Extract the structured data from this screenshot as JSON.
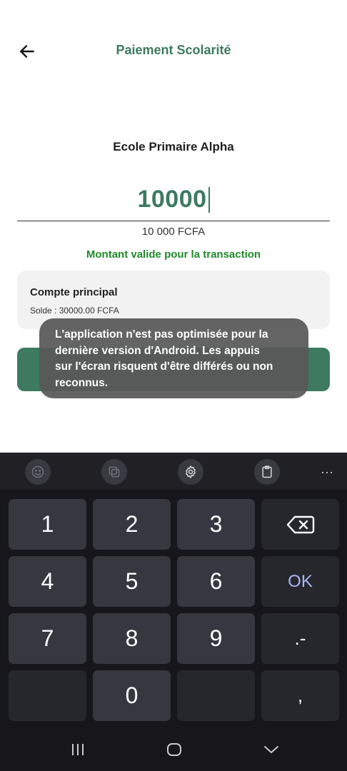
{
  "header": {
    "title": "Paiement Scolarité",
    "back_icon": "arrow-left-icon"
  },
  "payment": {
    "school_name": "Ecole Primaire Alpha",
    "amount": "10000",
    "formatted_amount": "10 000 FCFA",
    "validation_message": "Montant valide pour la transaction"
  },
  "account": {
    "name": "Compte principal",
    "balance": "Solde : 30000.00 FCFA"
  },
  "toast": {
    "lines": [
      "L'application  n'est pas optimisée pour la",
      "dernière version d'Android. Les appuis",
      "sur l'écran risquent d'être différés ou non",
      "reconnus."
    ]
  },
  "keyboard": {
    "toolbar_icons": [
      "emoji-icon",
      "stickers-icon",
      "settings-icon",
      "clipboard-icon",
      "more-icon"
    ],
    "more_label": "···",
    "keys": {
      "k1": "1",
      "k2": "2",
      "k3": "3",
      "k4": "4",
      "k5": "5",
      "k6": "6",
      "ok": "OK",
      "k7": "7",
      "k8": "8",
      "k9": "9",
      "dot_minus": ".-",
      "k0": "0",
      "comma": ","
    }
  },
  "colors": {
    "brand": "#3d7a5f",
    "valid": "#1f8a2a",
    "ok_key": "#a9b6f5"
  }
}
